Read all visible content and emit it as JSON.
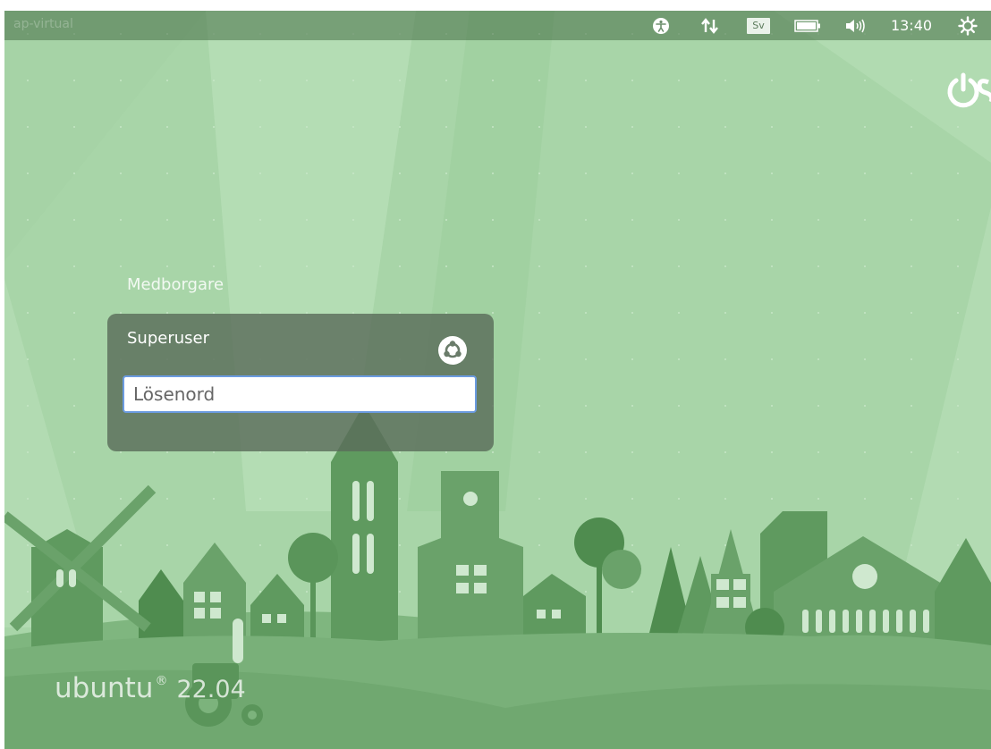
{
  "top_panel": {
    "hostname": "ap-virtual",
    "keyboard_layout": "Sv",
    "clock": "13:40",
    "icons": [
      "accessibility-icon",
      "network-icon",
      "battery-icon",
      "volume-icon",
      "settings-icon"
    ]
  },
  "greeter": {
    "users": [
      {
        "name": "Medborgare"
      },
      {
        "name": "Superuser"
      }
    ],
    "password_placeholder": "Lösenord",
    "password_value": ""
  },
  "branding": {
    "name": "ubuntu",
    "registered": "®",
    "version": "22.04"
  },
  "colors": {
    "background": "#a9d6a9",
    "panel": "#466e46",
    "card": "#5a6c5a",
    "input_focus": "#6b9be0"
  }
}
